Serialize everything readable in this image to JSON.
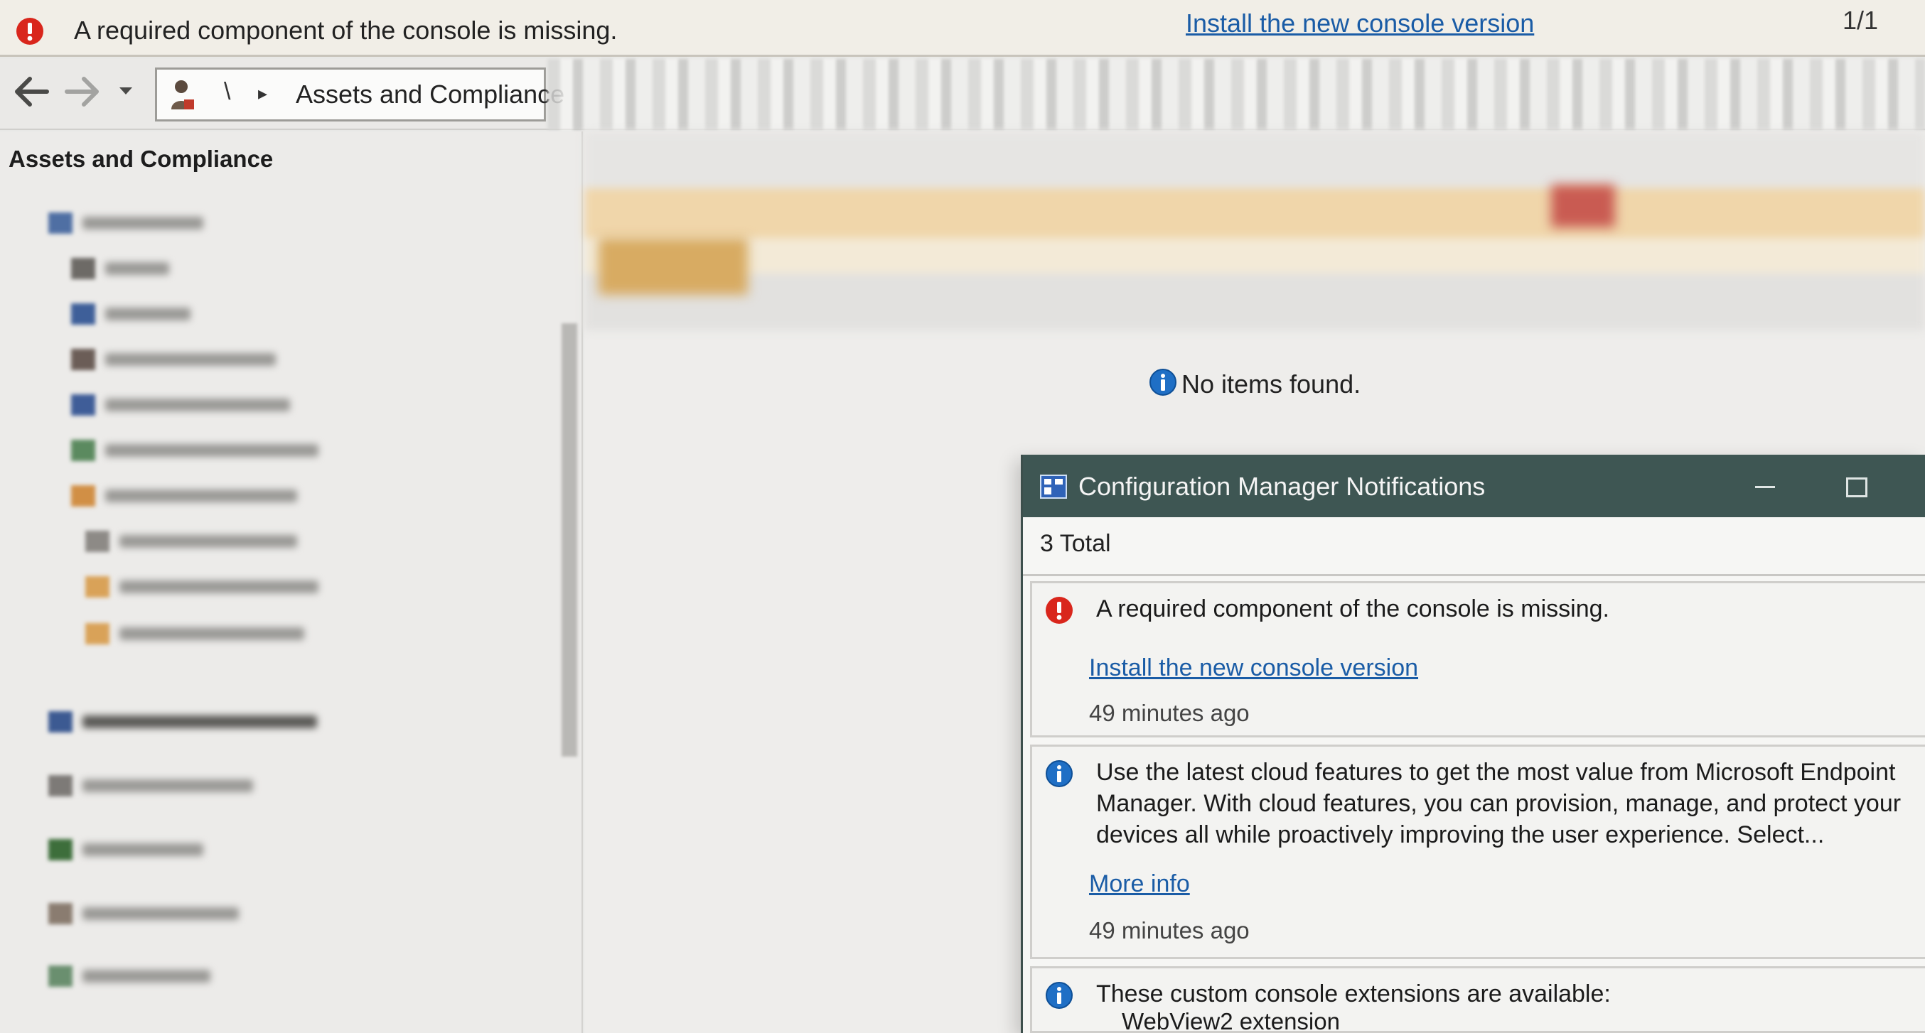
{
  "top_bar": {
    "message": "A required component of the console is missing.",
    "link": "Install the new console version",
    "counter": "1/1"
  },
  "nav": {
    "separator": "\\",
    "breadcrumb": "Assets and Compliance"
  },
  "left_pane": {
    "title": "Assets and Compliance"
  },
  "main": {
    "empty_message": "No items found."
  },
  "notifications_window": {
    "title": "Configuration Manager Notifications",
    "total": "3 Total",
    "items": [
      {
        "type": "error",
        "text": "A required component of the console is missing.",
        "link": "Install the new console version",
        "time": "49 minutes ago"
      },
      {
        "type": "info",
        "text": "Use the latest cloud features to get the most value from Microsoft Endpoint Manager. With cloud features, you can provision, manage, and protect your devices all while proactively improving the user experience. Select...",
        "link": "More info",
        "time": "49 minutes ago"
      },
      {
        "type": "info",
        "text": "These custom console extensions are available:",
        "subtext": "WebView2 extension"
      }
    ]
  },
  "colors": {
    "error_red": "#d9261c",
    "info_blue": "#1f6fc5",
    "link_blue": "#1a5ca6",
    "titlebar": "#3e5653"
  }
}
